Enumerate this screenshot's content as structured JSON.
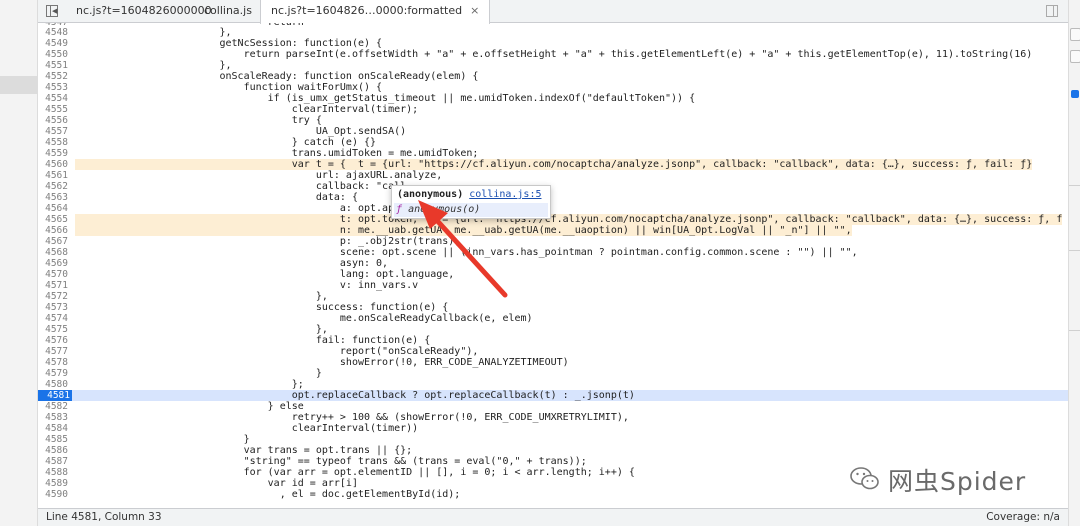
{
  "tabs": [
    {
      "label": "nc.js?t=1604826000000",
      "active": false
    },
    {
      "label": "collina.js",
      "active": false
    },
    {
      "label": "nc.js?t=1604826…0000:formatted",
      "active": true
    }
  ],
  "icons": {
    "tab_close": "×",
    "sidebar_toggle": "sidebar-toggle-icon",
    "breakpoint": "breakpoint-marker-icon",
    "watermark_logo": "wechat-icon"
  },
  "colors": {
    "exec_line_bg": "#d7e4fd",
    "exec_gutter": "#1a73e8",
    "arrow": "#e8392a",
    "value_highlight": "#fdeed4"
  },
  "code_lines": [
    {
      "n": "4548",
      "code": "                        },"
    },
    {
      "n": "4549",
      "code": "                        getNcSession: function(e) {"
    },
    {
      "n": "4550",
      "code": "                            return parseInt(e.offsetWidth + \"a\" + e.offsetHeight + \"a\" + this.getElementLeft(e) + \"a\" + this.getElementTop(e), 11).toString(16)"
    },
    {
      "n": "4551",
      "code": "                        },"
    },
    {
      "n": "4552",
      "code": "                        onScaleReady: function onScaleReady(elem) {"
    },
    {
      "n": "4553",
      "code": "                            function waitForUmx() {"
    },
    {
      "n": "4554",
      "code": "                                if (is_umx_getStatus_timeout || me.umidToken.indexOf(\"defaultToken\")) {"
    },
    {
      "n": "4555",
      "code": "                                    clearInterval(timer);"
    },
    {
      "n": "4556",
      "code": "                                    try {"
    },
    {
      "n": "4557",
      "code": "                                        UA_Opt.sendSA()"
    },
    {
      "n": "4558",
      "code": "                                    } catch (e) {}"
    },
    {
      "n": "4559",
      "code": "                                    trans.umidToken = me.umidToken;"
    },
    {
      "n": "4560",
      "code": "                                    var t = {  t = {url: \"https://cf.aliyun.com/nocaptcha/analyze.jsonp\", callback: \"callback\", data: {…}, success: ƒ, fail: ƒ}"
    },
    {
      "n": "4561",
      "code": "                                        url: ajaxURL.analyze,"
    },
    {
      "n": "4562",
      "code": "                                        callback: \"call"
    },
    {
      "n": "4563",
      "code": "                                        data: {"
    },
    {
      "n": "4564",
      "code": "                                            a: opt.appk"
    },
    {
      "n": "4565",
      "code": "                                            t: opt.token,  t = {url: \"https://cf.aliyun.com/nocaptcha/analyze.jsonp\", callback: \"callback\", data: {…}, success: ƒ, f"
    },
    {
      "n": "4566",
      "code": "                                            n: me.__uab.getUA  me.__uab.getUA(me.__uaoption) || win[UA_Opt.LogVal || \"_n\"] || \"\","
    },
    {
      "n": "4567",
      "code": "                                            p: _.obj2str(trans),"
    },
    {
      "n": "4568",
      "code": "                                            scene: opt.scene || (inn_vars.has_pointman ? pointman.config.common.scene : \"\") || \"\","
    },
    {
      "n": "4569",
      "code": "                                            asyn: 0,"
    },
    {
      "n": "4570",
      "code": "                                            lang: opt.language,"
    },
    {
      "n": "4571",
      "code": "                                            v: inn_vars.v"
    },
    {
      "n": "4572",
      "code": "                                        },"
    },
    {
      "n": "4573",
      "code": "                                        success: function(e) {"
    },
    {
      "n": "4574",
      "code": "                                            me.onScaleReadyCallback(e, elem)"
    },
    {
      "n": "4575",
      "code": "                                        },"
    },
    {
      "n": "4576",
      "code": "                                        fail: function(e) {"
    },
    {
      "n": "4577",
      "code": "                                            report(\"onScaleReady\"),"
    },
    {
      "n": "4578",
      "code": "                                            showError(!0, ERR_CODE_ANALYZETIMEOUT)"
    },
    {
      "n": "4579",
      "code": "                                        }"
    },
    {
      "n": "4580",
      "code": "                                    };"
    },
    {
      "n": "4581",
      "code": "                                    opt.replaceCallback ? opt.replaceCallback(t) : _.jsonp(t)"
    },
    {
      "n": "4582",
      "code": "                                } else"
    },
    {
      "n": "4583",
      "code": "                                    retry++ > 100 && (showError(!0, ERR_CODE_UMXRETRYLIMIT),"
    },
    {
      "n": "4584",
      "code": "                                    clearInterval(timer))"
    },
    {
      "n": "4585",
      "code": "                            }"
    },
    {
      "n": "4586",
      "code": "                            var trans = opt.trans || {};"
    },
    {
      "n": "4587",
      "code": "                            \"string\" == typeof trans && (trans = eval(\"0,\" + trans));"
    },
    {
      "n": "4588",
      "code": "                            for (var arr = opt.elementID || [], i = 0; i < arr.length; i++) {"
    },
    {
      "n": "4589",
      "code": "                                var id = arr[i]"
    },
    {
      "n": "4590",
      "code": "                                  , el = doc.getElementById(id);"
    }
  ],
  "tooltip": {
    "name": "(anonymous)",
    "link": "collina.js:5",
    "fn_prefix": "ƒ",
    "fn_text": "anonymous(o)"
  },
  "status": {
    "position": "Line 4581, Column 33",
    "coverage": "Coverage: n/a"
  },
  "watermark": {
    "text": "网虫Spider"
  }
}
